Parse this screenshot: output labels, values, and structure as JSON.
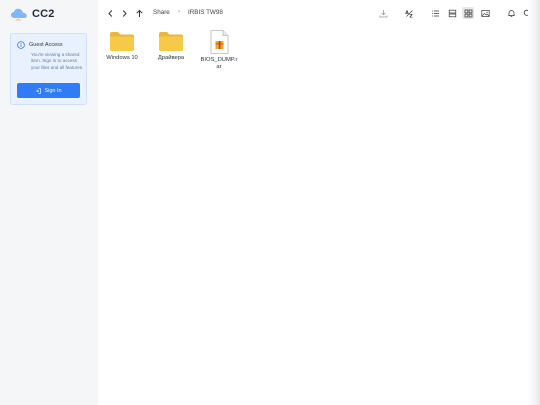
{
  "app": {
    "name": "CC2"
  },
  "guest": {
    "title": "Guest Access",
    "message": "You're viewing a shared item. Sign in to access your files and all features.",
    "signin_label": "Sign In"
  },
  "breadcrumb": {
    "root": "Share",
    "current": "IRBIS TW98"
  },
  "files": [
    {
      "name": "Windows 10",
      "type": "folder"
    },
    {
      "name": "Драйвера",
      "type": "folder"
    },
    {
      "name": "BIOS_DUMP.rar",
      "type": "archive"
    }
  ],
  "toolbar": {
    "active_view": "grid"
  },
  "colors": {
    "accent": "#2f7cf6",
    "folder": "#f7c948",
    "sidebar_bg": "#f5f6f8",
    "card_bg": "#e8f1fd"
  }
}
